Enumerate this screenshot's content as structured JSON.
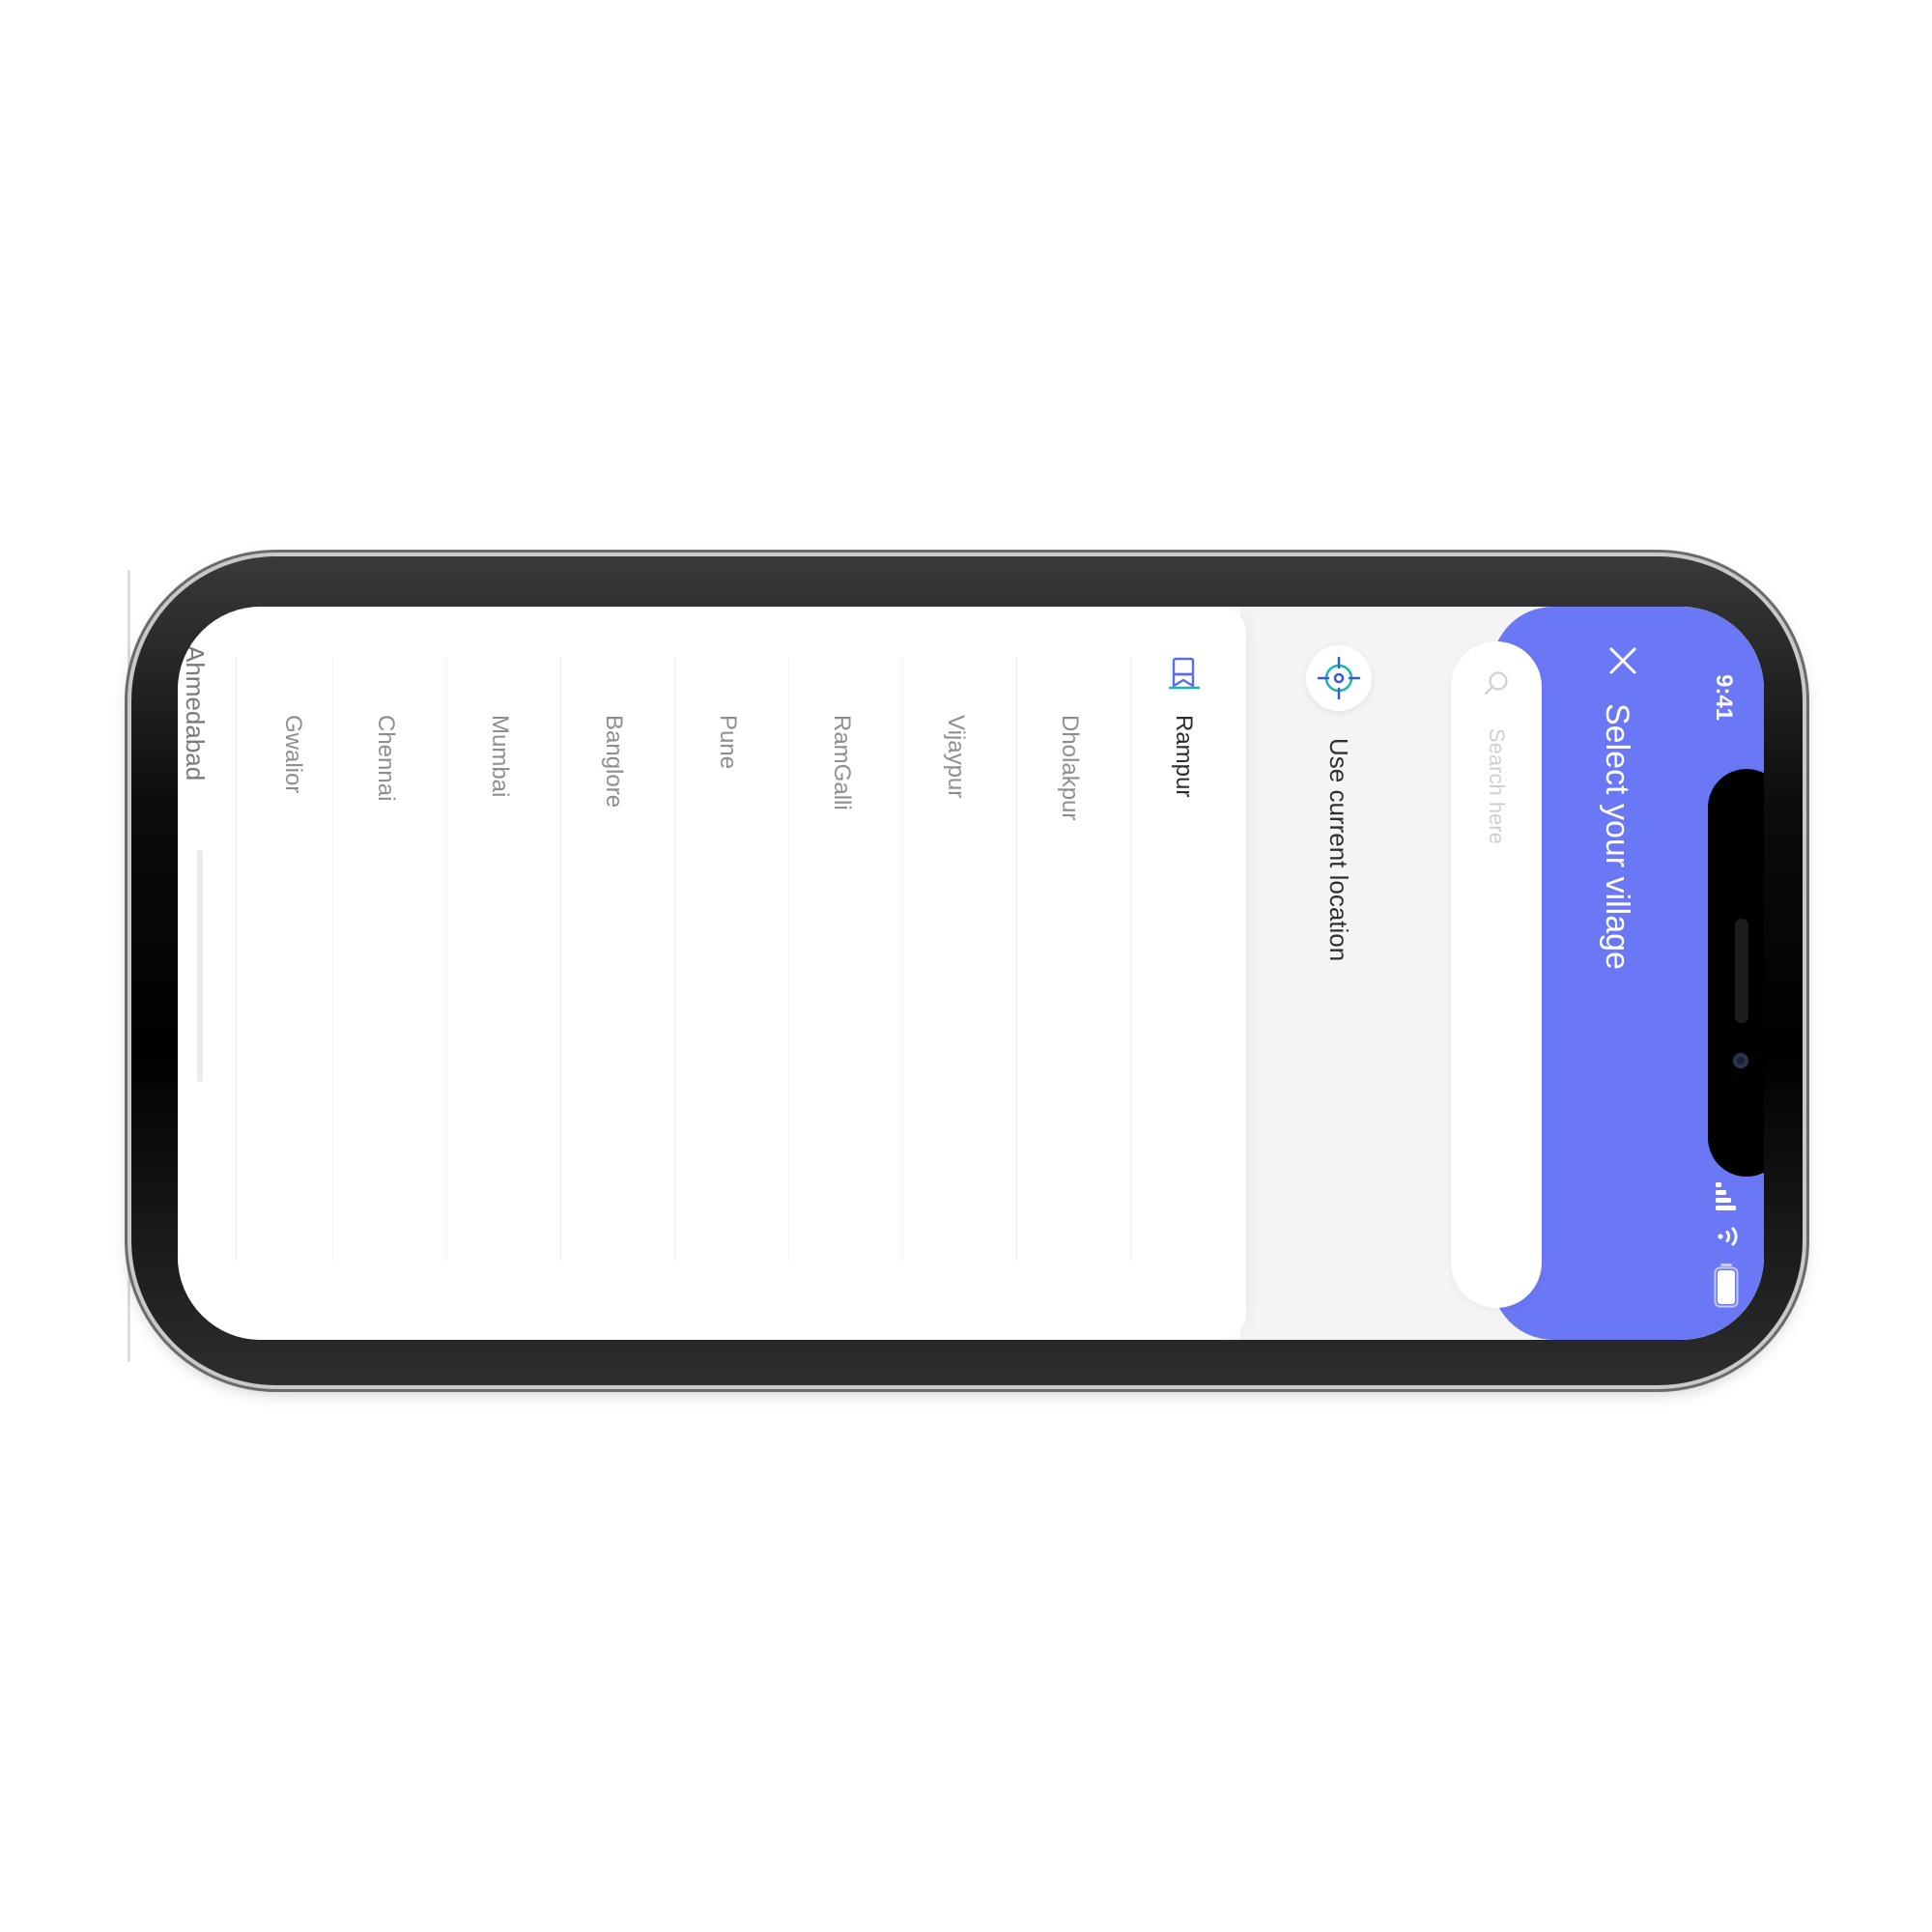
{
  "status_bar": {
    "time": "9:41",
    "icons": [
      "signal-icon",
      "wifi-icon",
      "battery-icon"
    ]
  },
  "header": {
    "title": "Select your village",
    "close_icon": "close-icon"
  },
  "search": {
    "placeholder": "Search here",
    "value": "",
    "icon": "search-icon"
  },
  "current_location": {
    "label": "Use current location",
    "icon": "crosshair-target-icon"
  },
  "villages": {
    "items": [
      {
        "name": "Rampur",
        "selected": true
      },
      {
        "name": "Dholakpur",
        "selected": false
      },
      {
        "name": "Vijaypur",
        "selected": false
      },
      {
        "name": "RamGalli",
        "selected": false
      },
      {
        "name": "Pune",
        "selected": false
      },
      {
        "name": "Banglore",
        "selected": false
      },
      {
        "name": "Mumbai",
        "selected": false
      },
      {
        "name": "Chennai",
        "selected": false
      },
      {
        "name": "Gwalior",
        "selected": false
      }
    ],
    "partially_visible": "Ahmedabad"
  },
  "colors": {
    "accent": "#6b78f5",
    "selected_flag": "#5a6cf0",
    "location_icon": "#1fb5b5",
    "background_panel": "#f4f4f6",
    "text_primary": "#2c2c2c",
    "text_secondary": "#8e8e8e"
  }
}
